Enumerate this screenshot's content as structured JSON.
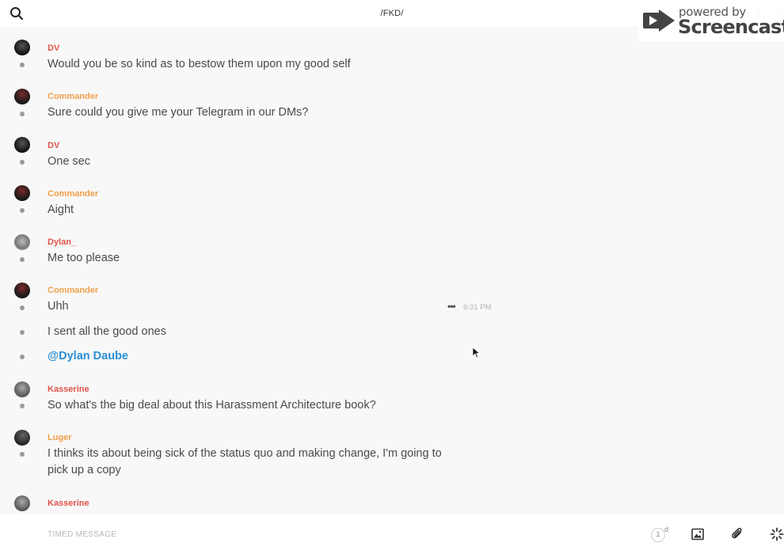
{
  "header": {
    "room_title": "/FKD/",
    "search_icon": "search-icon",
    "call_icon": "phone-icon",
    "info_icon": "info-icon"
  },
  "watermark": {
    "powered_text": "powered by",
    "brand_text": "Screencastify"
  },
  "messages": {
    "m1": {
      "author": "DV",
      "text": "Would you be so kind as to bestow them upon my good self"
    },
    "m2": {
      "author": "Commander",
      "text": "Sure could you give me your Telegram in our DMs?"
    },
    "m3": {
      "author": "DV",
      "text": "One sec"
    },
    "m4": {
      "author": "Commander",
      "text": "Aight"
    },
    "m5": {
      "author": "Dylan_",
      "text": "Me too please"
    },
    "m6": {
      "author": "Commander",
      "text": "Uhh",
      "time": "6:31 PM",
      "more": "•••"
    },
    "m7": {
      "text": "I sent all the good ones"
    },
    "m8": {
      "text": "@Dylan Daube"
    },
    "m9": {
      "author": "Kasserine",
      "text": "So what's the big deal about this Harassment Architecture book?"
    },
    "m10": {
      "author": "Luger",
      "text": "I thinks its about being sick of the status quo and making change, I'm going to pick up a copy"
    },
    "m11": {
      "author": "Kasserine"
    }
  },
  "composer": {
    "placeholder": "TIMED MESSAGE",
    "timer_value": "1",
    "timer_unit": "d"
  },
  "colors": {
    "author_red": "#e0534a",
    "author_orange": "#f0a04b",
    "mention_blue": "#2b8fd6"
  }
}
